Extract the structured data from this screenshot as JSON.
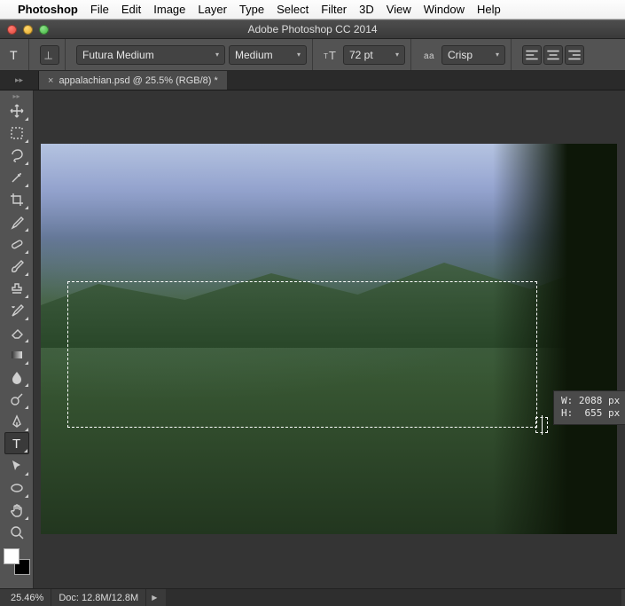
{
  "menubar": {
    "app": "Photoshop",
    "items": [
      "File",
      "Edit",
      "Image",
      "Layer",
      "Type",
      "Select",
      "Filter",
      "3D",
      "View",
      "Window",
      "Help"
    ]
  },
  "window": {
    "title": "Adobe Photoshop CC 2014"
  },
  "options": {
    "font_family": "Futura Medium",
    "font_style": "Medium",
    "font_size": "72 pt",
    "antialias": "Crisp"
  },
  "tab": {
    "label": "appalachian.psd @ 25.5% (RGB/8) *"
  },
  "tools": [
    {
      "name": "move-tool",
      "svg": "move",
      "corner": true
    },
    {
      "name": "marquee-tool",
      "svg": "marquee",
      "corner": true
    },
    {
      "name": "lasso-tool",
      "svg": "lasso",
      "corner": true
    },
    {
      "name": "quick-select-tool",
      "svg": "wand",
      "corner": true
    },
    {
      "name": "crop-tool",
      "svg": "crop",
      "corner": true
    },
    {
      "name": "eyedropper-tool",
      "svg": "eyedropper",
      "corner": true
    },
    {
      "name": "healing-brush-tool",
      "svg": "bandaid",
      "corner": true
    },
    {
      "name": "brush-tool",
      "svg": "brush",
      "corner": true
    },
    {
      "name": "clone-stamp-tool",
      "svg": "stamp",
      "corner": true
    },
    {
      "name": "history-brush-tool",
      "svg": "hbrush",
      "corner": true
    },
    {
      "name": "eraser-tool",
      "svg": "eraser",
      "corner": true
    },
    {
      "name": "gradient-tool",
      "svg": "gradient",
      "corner": true
    },
    {
      "name": "blur-tool",
      "svg": "blur",
      "corner": true
    },
    {
      "name": "dodge-tool",
      "svg": "dodge",
      "corner": true
    },
    {
      "name": "pen-tool",
      "svg": "pen",
      "corner": true
    },
    {
      "name": "type-tool",
      "svg": "type",
      "corner": true,
      "active": true
    },
    {
      "name": "path-select-tool",
      "svg": "pathsel",
      "corner": true
    },
    {
      "name": "shape-tool",
      "svg": "ellipse",
      "corner": true
    },
    {
      "name": "hand-tool",
      "svg": "hand",
      "corner": true
    },
    {
      "name": "zoom-tool",
      "svg": "zoom",
      "corner": false
    }
  ],
  "selection": {
    "w_label": "W: 2088 px",
    "h_label": "H:  655 px"
  },
  "status": {
    "zoom": "25.46%",
    "doc": "Doc: 12.8M/12.8M"
  }
}
